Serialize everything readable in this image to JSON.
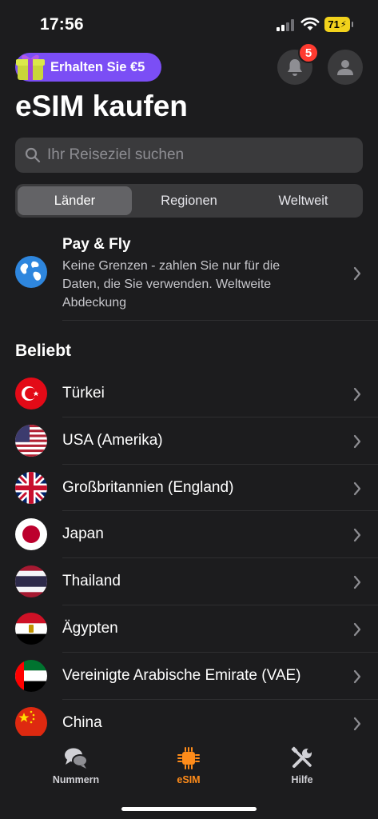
{
  "status_bar": {
    "time": "17:56",
    "battery": "71"
  },
  "promo": {
    "label": "Erhalten Sie €5"
  },
  "header": {
    "notification_count": "5",
    "title": "eSIM kaufen"
  },
  "search": {
    "placeholder": "Ihr Reiseziel suchen"
  },
  "tabs": [
    {
      "label": "Länder",
      "active": true
    },
    {
      "label": "Regionen",
      "active": false
    },
    {
      "label": "Weltweit",
      "active": false
    }
  ],
  "pay_and_fly": {
    "title": "Pay & Fly",
    "description": "Keine Grenzen - zahlen Sie nur für die Daten, die Sie verwenden. Weltweite Abdeckung"
  },
  "popular": {
    "title": "Beliebt",
    "countries": [
      {
        "name": "Türkei",
        "flag": "turkey-flag-icon"
      },
      {
        "name": "USA (Amerika)",
        "flag": "usa-flag-icon"
      },
      {
        "name": "Großbritannien (England)",
        "flag": "uk-flag-icon"
      },
      {
        "name": "Japan",
        "flag": "japan-flag-icon"
      },
      {
        "name": "Thailand",
        "flag": "thailand-flag-icon"
      },
      {
        "name": "Ägypten",
        "flag": "egypt-flag-icon"
      },
      {
        "name": "Vereinigte Arabische Emirate (VAE)",
        "flag": "uae-flag-icon"
      },
      {
        "name": "China",
        "flag": "china-flag-icon"
      }
    ]
  },
  "bottom_nav": {
    "items": [
      {
        "label": "Nummern",
        "icon": "chat-bubbles-icon"
      },
      {
        "label": "eSIM",
        "icon": "chip-icon",
        "active": true
      },
      {
        "label": "Hilfe",
        "icon": "tools-icon"
      }
    ]
  },
  "colors": {
    "background": "#1c1c1e",
    "accent_purple": "#7b4ef5",
    "accent_orange": "#ff8c1a",
    "badge_red": "#ff3b30"
  }
}
